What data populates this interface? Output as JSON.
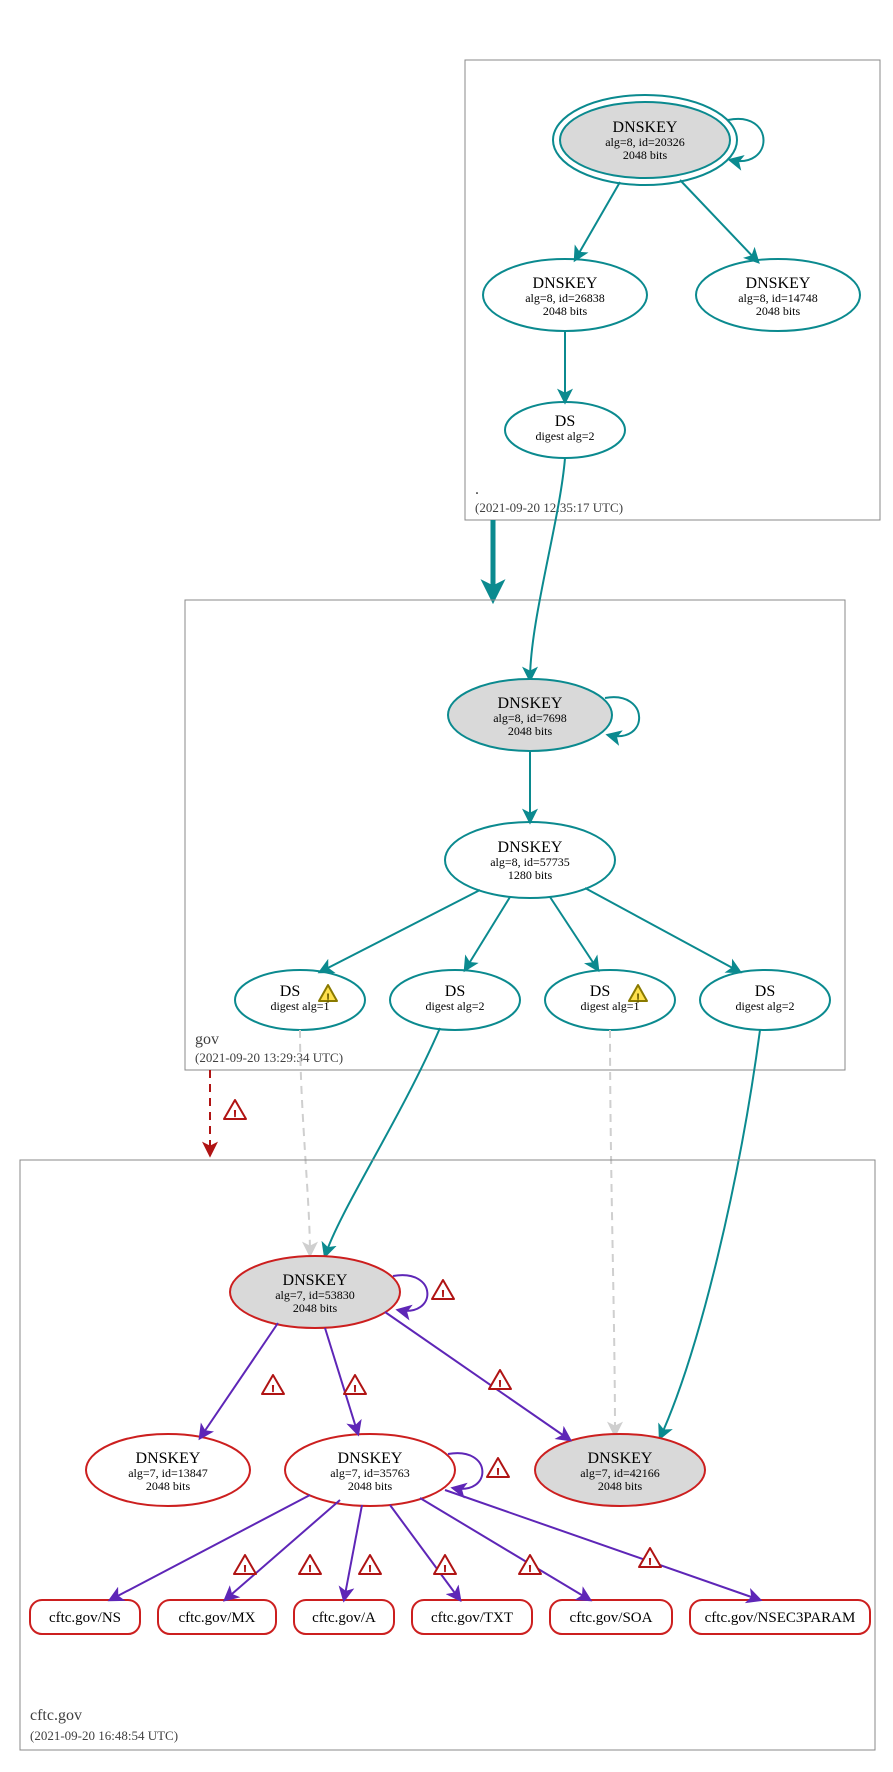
{
  "zones": {
    "root": {
      "name": ".",
      "timestamp": "(2021-09-20 12:35:17 UTC)"
    },
    "gov": {
      "name": "gov",
      "timestamp": "(2021-09-20 13:29:34 UTC)"
    },
    "cftc": {
      "name": "cftc.gov",
      "timestamp": "(2021-09-20 16:48:54 UTC)"
    }
  },
  "root_dnskey_ksk": {
    "title": "DNSKEY",
    "sub1": "alg=8, id=20326",
    "sub2": "2048 bits"
  },
  "root_dnskey_26838": {
    "title": "DNSKEY",
    "sub1": "alg=8, id=26838",
    "sub2": "2048 bits"
  },
  "root_dnskey_14748": {
    "title": "DNSKEY",
    "sub1": "alg=8, id=14748",
    "sub2": "2048 bits"
  },
  "root_ds": {
    "title": "DS",
    "sub1": "digest alg=2"
  },
  "gov_dnskey_7698": {
    "title": "DNSKEY",
    "sub1": "alg=8, id=7698",
    "sub2": "2048 bits"
  },
  "gov_dnskey_57735": {
    "title": "DNSKEY",
    "sub1": "alg=8, id=57735",
    "sub2": "1280 bits"
  },
  "gov_ds_1a": {
    "title": "DS",
    "sub1": "digest alg=1"
  },
  "gov_ds_2a": {
    "title": "DS",
    "sub1": "digest alg=2"
  },
  "gov_ds_1b": {
    "title": "DS",
    "sub1": "digest alg=1"
  },
  "gov_ds_2b": {
    "title": "DS",
    "sub1": "digest alg=2"
  },
  "cftc_dnskey_53830": {
    "title": "DNSKEY",
    "sub1": "alg=7, id=53830",
    "sub2": "2048 bits"
  },
  "cftc_dnskey_13847": {
    "title": "DNSKEY",
    "sub1": "alg=7, id=13847",
    "sub2": "2048 bits"
  },
  "cftc_dnskey_35763": {
    "title": "DNSKEY",
    "sub1": "alg=7, id=35763",
    "sub2": "2048 bits"
  },
  "cftc_dnskey_42166": {
    "title": "DNSKEY",
    "sub1": "alg=7, id=42166",
    "sub2": "2048 bits"
  },
  "rr": {
    "ns": "cftc.gov/NS",
    "mx": "cftc.gov/MX",
    "a": "cftc.gov/A",
    "txt": "cftc.gov/TXT",
    "soa": "cftc.gov/SOA",
    "nsec": "cftc.gov/NSEC3PARAM"
  }
}
